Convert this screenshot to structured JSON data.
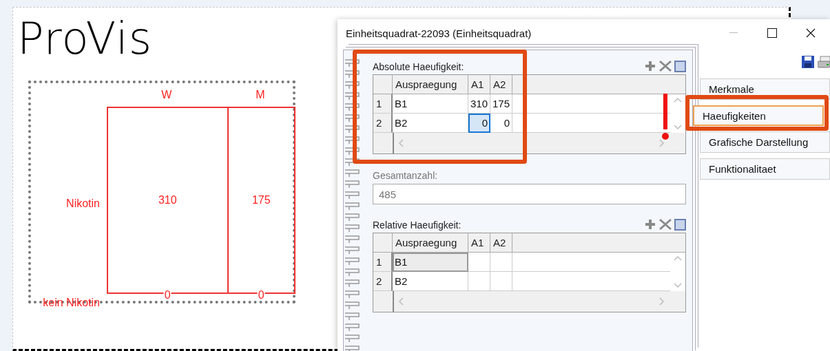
{
  "canvas": {
    "logo": "ProVis",
    "mosaic": {
      "columns": [
        "W",
        "M"
      ],
      "rows": [
        {
          "label": "Nikotin",
          "values": [
            "310",
            "175"
          ]
        },
        {
          "label": "kein Nikotin",
          "values": [
            "0",
            "0"
          ]
        }
      ]
    }
  },
  "dialog": {
    "title": "Einheitsquadrat-22093 (Einheitsquadrat)",
    "absolute": {
      "label": "Absolute Haeufigkeit:",
      "columns": [
        "Auspraegung",
        "A1",
        "A2"
      ],
      "rows": [
        {
          "number": "1",
          "cells": [
            {
              "text": "B1",
              "selected": false
            },
            {
              "text": "310",
              "selected": false
            },
            {
              "text": "175",
              "selected": false
            }
          ]
        },
        {
          "number": "2",
          "cells": [
            {
              "text": "B2",
              "selected": false
            },
            {
              "text": "0",
              "selected": true
            },
            {
              "text": "0",
              "selected": false
            }
          ]
        }
      ]
    },
    "total": {
      "label": "Gesamtanzahl:",
      "value": "485"
    },
    "relative": {
      "label": "Relative Haeufigkeit:",
      "columns": [
        "Auspraegung",
        "A1",
        "A2"
      ],
      "rows": [
        {
          "number": "1",
          "cells": [
            {
              "text": "B1",
              "selected": true
            },
            {
              "selected": false
            },
            {
              "selected": false
            }
          ]
        },
        {
          "number": "2",
          "cells": [
            {
              "text": "B2",
              "selected": false
            },
            {
              "selected": false
            },
            {
              "selected": false
            }
          ]
        }
      ]
    },
    "tabs": [
      {
        "label": "Merkmale",
        "selected": false
      },
      {
        "label": "Haeufigkeiten",
        "selected": true
      },
      {
        "label": "Grafische Darstellung",
        "selected": false
      },
      {
        "label": "Funktionalitaet",
        "selected": false
      }
    ]
  }
}
